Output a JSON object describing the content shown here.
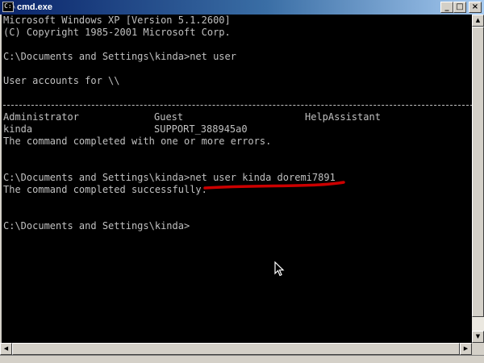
{
  "window": {
    "title": "cmd.exe",
    "icon": "console-app-icon",
    "icon_glyph": "C:\\",
    "buttons": {
      "minimize": "_",
      "maximize": "□",
      "close": "×"
    }
  },
  "console": {
    "lines": [
      "Microsoft Windows XP [Version 5.1.2600]",
      "(C) Copyright 1985-2001 Microsoft Corp.",
      "",
      "C:\\Documents and Settings\\kinda>net user",
      "",
      "User accounts for \\\\",
      "",
      "",
      "",
      "",
      "The command completed with one or more errors.",
      "",
      "",
      "C:\\Documents and Settings\\kinda>net user kinda doremi7891",
      "The command completed successfully.",
      "",
      "",
      "C:\\Documents and Settings\\kinda>"
    ],
    "user_table": [
      [
        "Administrator",
        "Guest",
        "HelpAssistant"
      ],
      [
        "kinda",
        "SUPPORT_388945a0",
        ""
      ]
    ],
    "text_color": "#c0c0c0",
    "background": "#000000",
    "annotation_color": "#cc0000"
  },
  "scrollbars": {
    "up_arrow": "▲",
    "down_arrow": "▼",
    "left_arrow": "◀",
    "right_arrow": "▶"
  }
}
